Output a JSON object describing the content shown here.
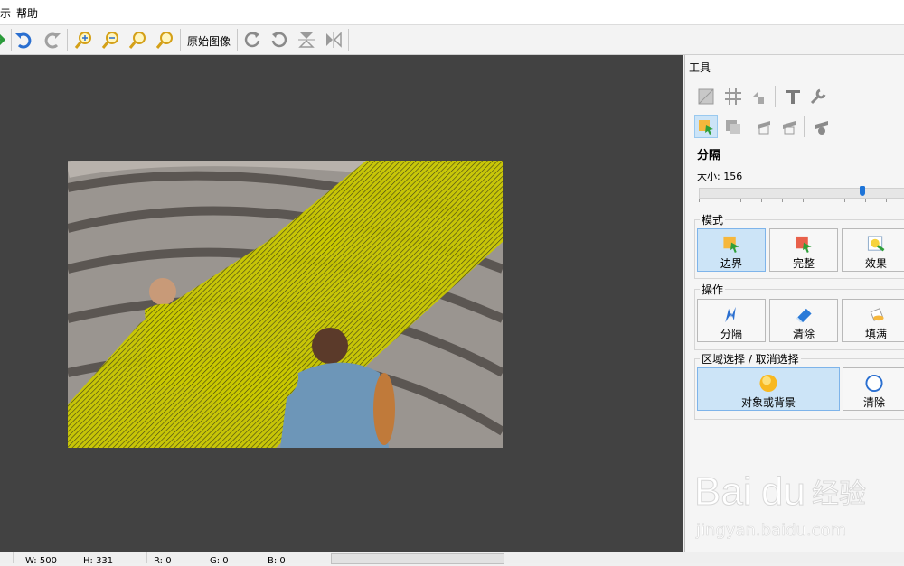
{
  "menu": {
    "items": [
      "示",
      "帮助"
    ]
  },
  "toolbar": {
    "original_image_label": "原始图像",
    "icons": [
      "redo-arrow-icon",
      "undo-icon",
      "redo-icon",
      "zoom-in-icon",
      "zoom-out-icon",
      "zoom-fit-icon",
      "zoom-actual-icon",
      "rotate-cw-icon",
      "rotate-ccw-icon",
      "flip-vertical-icon",
      "flip-horizontal-icon"
    ]
  },
  "panel": {
    "title": "工具",
    "section_title": "分隔",
    "size_label": "大小: 156",
    "size_value": 156,
    "mode": {
      "label": "模式",
      "buttons": [
        {
          "label": "边界",
          "active": true
        },
        {
          "label": "完整",
          "active": false
        },
        {
          "label": "效果",
          "active": false
        }
      ]
    },
    "operation": {
      "label": "操作",
      "buttons": [
        {
          "label": "分隔"
        },
        {
          "label": "清除"
        },
        {
          "label": "填满"
        }
      ]
    },
    "region": {
      "label": "区域选择 / 取消选择",
      "buttons": [
        {
          "label": "对象或背景",
          "active": true
        },
        {
          "label": "清除",
          "active": false
        }
      ]
    }
  },
  "status": {
    "width": "W: 500",
    "height": "H: 331",
    "r": "R: 0",
    "g": "G: 0",
    "b": "B: 0"
  },
  "watermark": {
    "brand": "Bai",
    "brand2": "du",
    "cn": "经验",
    "url": "jingyan.baidu.com"
  },
  "colors": {
    "selection": "#cfcf00",
    "accent": "#1e74d8",
    "canvas": "#424242",
    "active_button": "#cce4f7"
  }
}
